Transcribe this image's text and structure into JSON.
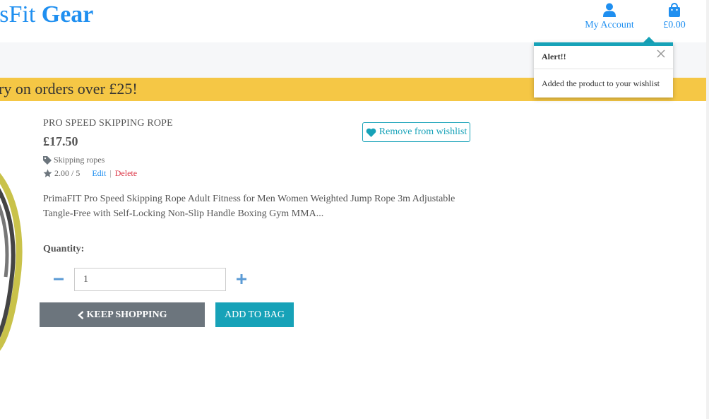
{
  "header": {
    "brand_part1": "ssFit ",
    "brand_part2": "Gear",
    "account_label": "My Account",
    "account_icon": "user-icon",
    "bag_total": "£0.00",
    "bag_icon": "shopping-bag-icon",
    "brand_color": "#1f8ff0"
  },
  "promo": {
    "text": "ry on orders over £25!",
    "color": "#f5c745"
  },
  "product": {
    "name": "PRO SPEED SKIPPING ROPE",
    "price": "£17.50",
    "category": "Skipping ropes",
    "category_icon": "tag-icon",
    "rating": "2.00 / 5",
    "rating_icon": "star-icon",
    "edit_label": "Edit",
    "separator": "|",
    "delete_label": "Delete",
    "description": "PrimaFIT Pro Speed Skipping Rope Adult Fitness for Men Women Weighted Jump Rope 3m Adjustable Tangle-Free with Self-Locking Non-Slip Handle Boxing Gym MMA...",
    "wishlist_label": "Remove from wishlist",
    "wishlist_icon": "heart-icon"
  },
  "quantity": {
    "label": "Quantity:",
    "value": "1",
    "minus_icon": "minus-icon",
    "plus_icon": "plus-icon"
  },
  "actions": {
    "keep_shopping_label": "KEEP SHOPPING",
    "keep_shopping_icon": "chevron-left-icon",
    "add_to_bag_label": "ADD TO BAG"
  },
  "toast": {
    "title": "Alert!!",
    "message": "Added the product to your wishlist",
    "close_icon": "close-icon",
    "accent": "#17a2b8"
  }
}
